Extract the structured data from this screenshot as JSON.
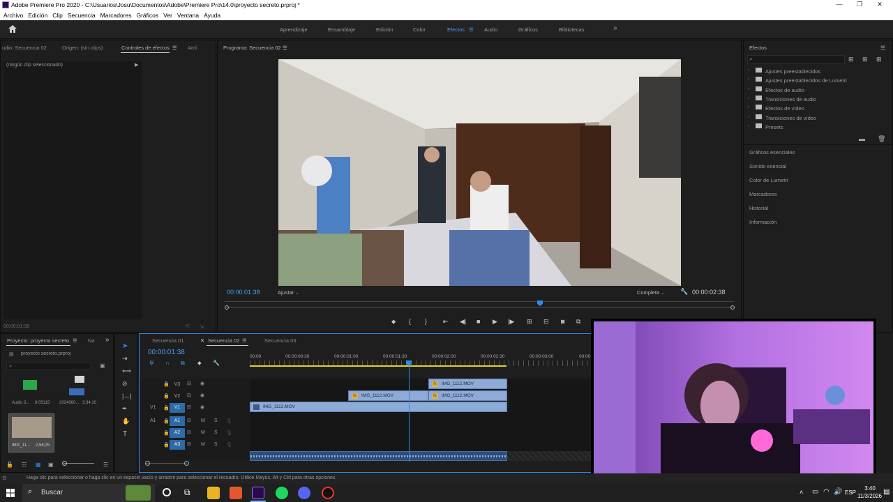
{
  "window": {
    "title": "Adobe Premiere Pro 2020 - C:\\Usuarios\\Josu\\Documentos\\Adobe\\Premiere Pro\\14.0\\proyecto secreto.prproj *"
  },
  "menu": [
    "Archivo",
    "Edición",
    "Clip",
    "Secuencia",
    "Marcadores",
    "Gráficos",
    "Ver",
    "Ventana",
    "Ayuda"
  ],
  "workspaces": [
    "Aprendizaje",
    "Ensamblaje",
    "Edición",
    "Color",
    "Efectos",
    "Audio",
    "Gráficos",
    "Bibliotecas"
  ],
  "active_workspace": "Efectos",
  "left_panel": {
    "tabs": [
      "udio: Secuencia 02",
      "Origen: (sin clips)",
      "Controles de efectos",
      "Aml"
    ],
    "no_clip": "(ningún clip seleccionado)",
    "timecode": "00:00:01:38"
  },
  "program": {
    "title": "Programa: Secuencia 02",
    "timecode": "00:00:01:38",
    "fit": "Ajustar",
    "quality": "Completa",
    "duration": "00:00:02:38"
  },
  "effects": {
    "title": "Efectos",
    "items": [
      "Ajustes preestablecidos",
      "Ajustes preestablecidos de Lumetri",
      "Efectos de audio",
      "Transiciones de audio",
      "Efectos de vídeo",
      "Transiciones de vídeo",
      "Presets"
    ]
  },
  "right_panels": [
    "Gráficos esenciales",
    "Sonido esencial",
    "Color de Lumetri",
    "Marcadores",
    "Historial",
    "Información"
  ],
  "project": {
    "tabs": [
      "Proyecto: proyecto secreto",
      "Na"
    ],
    "file": "proyecto secreto.prproj",
    "items": [
      {
        "name": "Audio 3...",
        "duration": "8:05115"
      },
      {
        "name": "2024060...",
        "duration": "3;34;10"
      },
      {
        "name": "IMG_11...",
        "duration": "2;56;25"
      }
    ]
  },
  "timeline": {
    "tabs": [
      "Secuencia 01",
      "Secuencia 02",
      "Secuencia 03"
    ],
    "active_tab": "Secuencia 02",
    "timecode": "00:00:01:38",
    "ruler": [
      "00:00",
      "00:00:00:30",
      "00:00:01:00",
      "00:00:01:30",
      "00:00:02:00",
      "00:00:02:30",
      "00:00:03:00",
      "00:00"
    ],
    "tracks": [
      {
        "name": "V3",
        "src": ""
      },
      {
        "name": "V2",
        "src": ""
      },
      {
        "name": "V1",
        "src": "V1"
      },
      {
        "name": "A1",
        "src": "A1"
      },
      {
        "name": "A2",
        "src": ""
      },
      {
        "name": "A3",
        "src": ""
      }
    ],
    "clips": {
      "v3": "IMG_1112.MOV",
      "v2a": "IMG_1112.MOV",
      "v2b": "IMG_1112.MOV",
      "v1": "IMG_1112.MOV"
    },
    "mute": "M",
    "solo": "S"
  },
  "status": "Haga clic para seleccionar o haga clic en un espacio vacío y arrastre para seleccionar el recuadro. Utilice Mayús, Alt y Ctrl para otras opciones.",
  "taskbar": {
    "search": "Buscar",
    "lang": "ESP",
    "time": "3:40",
    "date": "11/3/2026"
  }
}
